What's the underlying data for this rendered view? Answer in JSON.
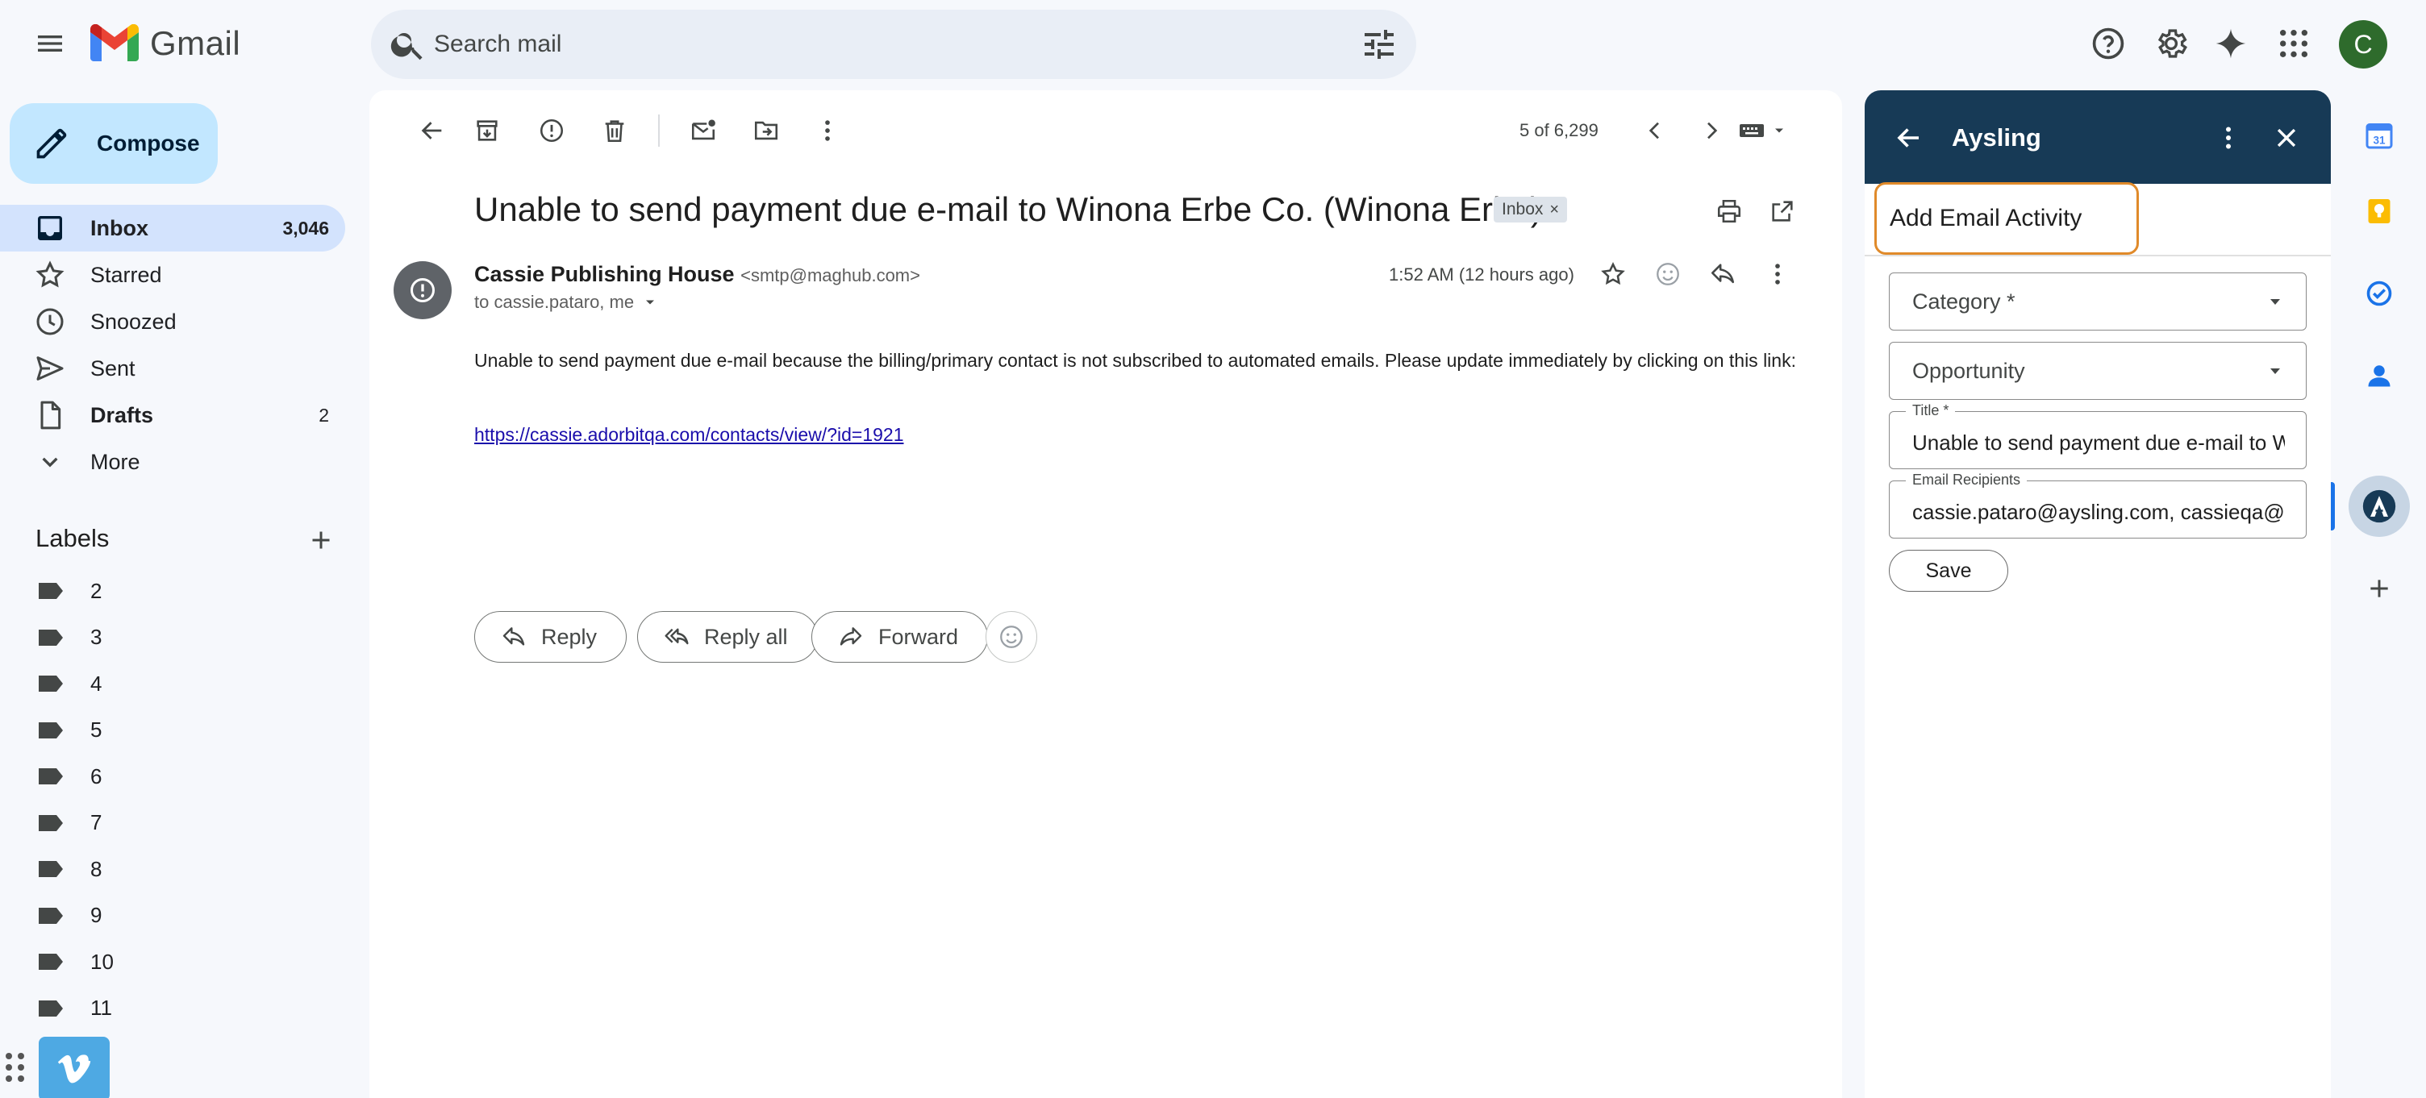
{
  "app": {
    "wordmark": "Gmail",
    "avatar_initial": "C"
  },
  "search": {
    "placeholder": "Search mail"
  },
  "compose": {
    "label": "Compose"
  },
  "nav": {
    "items": [
      {
        "label": "Inbox",
        "count": "3,046",
        "icon": "inbox-icon"
      },
      {
        "label": "Starred",
        "count": "",
        "icon": "star-icon"
      },
      {
        "label": "Snoozed",
        "count": "",
        "icon": "clock-icon"
      },
      {
        "label": "Sent",
        "count": "",
        "icon": "send-icon"
      },
      {
        "label": "Drafts",
        "count": "2",
        "icon": "draft-icon"
      },
      {
        "label": "More",
        "count": "",
        "icon": "chevron-down-icon"
      }
    ]
  },
  "labels": {
    "heading": "Labels",
    "items": [
      "2",
      "3",
      "4",
      "5",
      "6",
      "7",
      "8",
      "9",
      "10",
      "11"
    ]
  },
  "toolbar": {
    "pager": "5 of 6,299"
  },
  "email": {
    "subject": "Unable to send payment due e-mail to Winona Erbe Co. (Winona Erbe)",
    "chip": "Inbox",
    "chip_close": "×",
    "sender_name": "Cassie Publishing House",
    "sender_email": "<smtp@maghub.com>",
    "recipients": "to cassie.pataro, me",
    "time": "1:52 AM (12 hours ago)",
    "body": "Unable to send payment due e-mail because the billing/primary contact is not subscribed to automated emails. Please update immediately by clicking on this link:",
    "link": "https://cassie.adorbitqa.com/contacts/view/?id=1921"
  },
  "reply_actions": {
    "reply": "Reply",
    "reply_all": "Reply all",
    "forward": "Forward"
  },
  "aysling": {
    "title": "Aysling",
    "subtitle": "Add Email Activity",
    "category_placeholder": "Category *",
    "opportunity_placeholder": "Opportunity",
    "title_label": "Title *",
    "title_value": "Unable to send payment due e-mail to Winona Erbe Co. (Winona Erbe)",
    "recipients_label": "Email Recipients",
    "recipients_value": "cassie.pataro@aysling.com, cassieqa@gmail.com",
    "save": "Save"
  },
  "colors": {
    "compose_bg": "#c2e7ff",
    "active_nav": "#d3e3fd",
    "aysling_header": "#173a56",
    "highlight": "#e08a2a",
    "avatar": "#2e6b2c",
    "link": "#1a0dab"
  }
}
